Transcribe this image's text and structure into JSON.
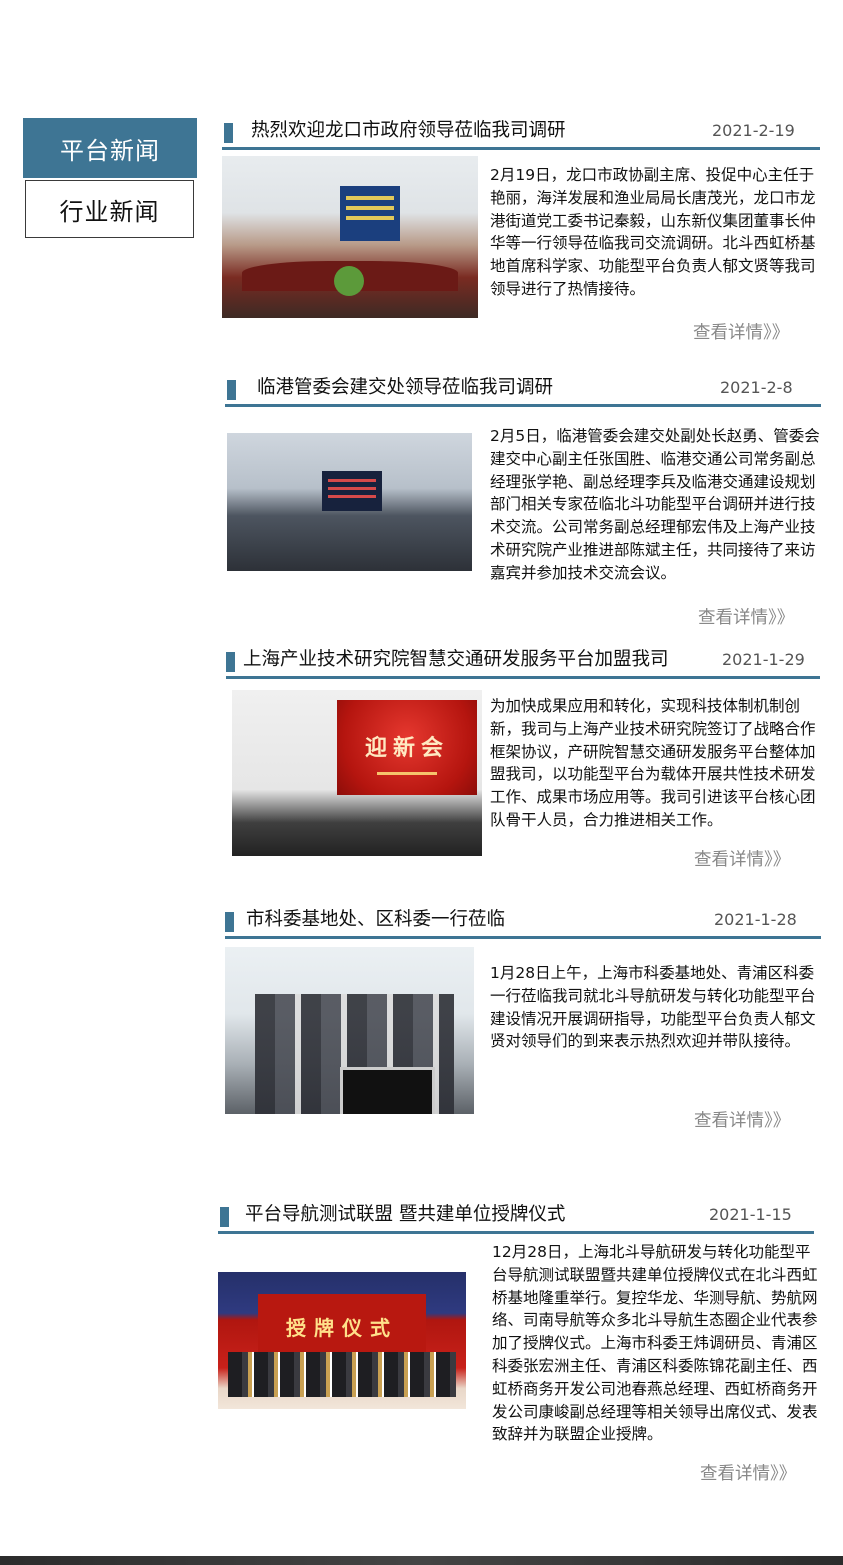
{
  "tabs": {
    "active": "平台新闻",
    "inactive": "行业新闻"
  },
  "news": [
    {
      "title": "热烈欢迎龙口市政府领导莅临我司调研",
      "date": "2021-2-19",
      "body": "2月19日，龙口市政协副主席、投促中心主任于艳丽，海洋发展和渔业局局长唐茂光，龙口市龙港街道党工委书记秦毅，山东新仪集团董事长仲华等一行领导莅临我司交流调研。北斗西虹桥基地首席科学家、功能型平台负责人郁文贤等我司领导进行了热情接待。",
      "more": "查看详情》》"
    },
    {
      "title": "临港管委会建交处领导莅临我司调研",
      "date": "2021-2-8",
      "body": "2月5日，临港管委会建交处副处长赵勇、管委会建交中心副主任张国胜、临港交通公司常务副总经理张学艳、副总经理李兵及临港交通建设规划部门相关专家莅临北斗功能型平台调研并进行技术交流。公司常务副总经理郁宏伟及上海产业技术研究院产业推进部陈斌主任，共同接待了来访嘉宾并参加技术交流会议。",
      "more": "查看详情》》"
    },
    {
      "title": "上海产业技术研究院智慧交通研发服务平台加盟我司",
      "date": "2021-1-29",
      "body": "为加快成果应用和转化，实现科技体制机制创新，我司与上海产业技术研究院签订了战略合作框架协议，产研院智慧交通研发服务平台整体加盟我司，以功能型平台为载体开展共性技术研发工作、成果市场应用等。我司引进该平台核心团队骨干人员，合力推进相关工作。",
      "more": "查看详情》》"
    },
    {
      "title": "市科委基地处、区科委一行莅临",
      "date": "2021-1-28",
      "body": "1月28日上午，上海市科委基地处、青浦区科委一行莅临我司就北斗导航研发与转化功能型平台建设情况开展调研指导，功能型平台负责人郁文贤对领导们的到来表示热烈欢迎并带队接待。",
      "more": "查看详情》》"
    },
    {
      "title": "平台导航测试联盟 暨共建单位授牌仪式",
      "date": "2021-1-15",
      "body": "12月28日，上海北斗导航研发与转化功能型平台导航测试联盟暨共建单位授牌仪式在北斗西虹桥基地隆重举行。复控华龙、华测导航、势航网络、司南导航等众多北斗导航生态圈企业代表参加了授牌仪式。上海市科委王炜调研员、青浦区科委张宏洲主任、青浦区科委陈锦花副主任、西虹桥商务开发公司池春燕总经理、西虹桥商务开发公司康峻副总经理等相关领导出席仪式、发表致辞并为联盟企业授牌。",
      "more": "查看详情》》"
    }
  ],
  "images": {
    "img3_banner": "迎新会",
    "img5_banner": "授牌仪式"
  },
  "colors": {
    "accent": "#3e7594",
    "text": "#111111",
    "muted": "#888888"
  }
}
